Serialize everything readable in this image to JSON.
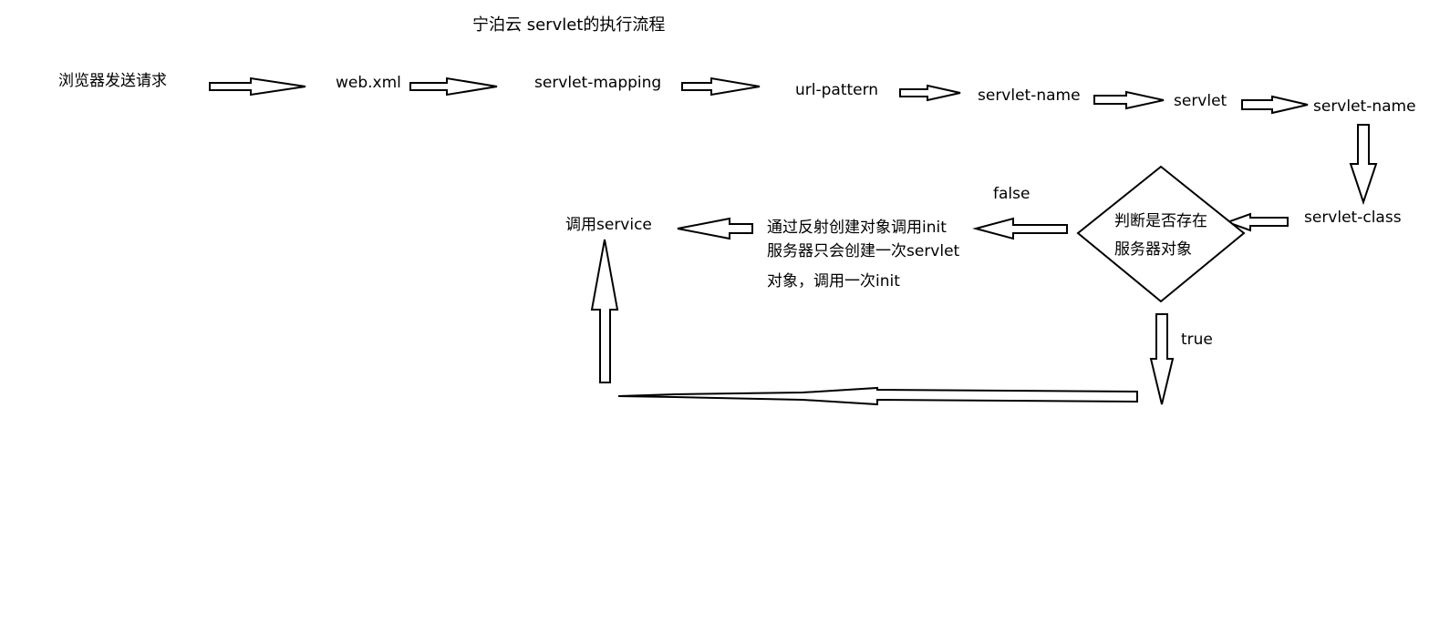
{
  "title": "宁泊云 servlet的执行流程",
  "nodes": {
    "browser": "浏览器发送请求",
    "webxml": "web.xml",
    "mapping": "servlet-mapping",
    "pattern": "url-pattern",
    "name1": "servlet-name",
    "servlet": "servlet",
    "name2": "servlet-name",
    "servlet_class": "servlet-class",
    "decision_line1": "判断是否存在",
    "decision_line2": "服务器对象",
    "reflect_line1": "通过反射创建对象调用init",
    "reflect_line2": "服务器只会创建一次servlet",
    "reflect_line3": "对象，调用一次init",
    "call_service": "调用service"
  },
  "edge_labels": {
    "false_label": "false",
    "true_label": "true"
  }
}
